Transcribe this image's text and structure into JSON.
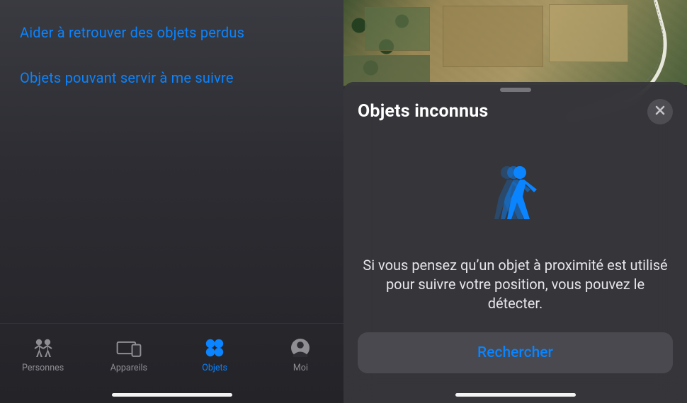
{
  "left": {
    "links": [
      "Aider à retrouver des objets perdus",
      "Objets pouvant servir à me suivre"
    ],
    "tabs": {
      "people": "Personnes",
      "devices": "Appareils",
      "items": "Objets",
      "me": "Moi",
      "active": "items"
    }
  },
  "sheet": {
    "title": "Objets inconnus",
    "close_icon": "close-icon",
    "graphic": "walking-person-icon",
    "description": "Si vous pensez qu’un objet à proximité est utilisé pour suivre votre position, vous pouvez le détecter.",
    "search_button": "Rechercher"
  },
  "colors": {
    "accent": "#0a84ff",
    "text_secondary": "#8e8e93"
  }
}
